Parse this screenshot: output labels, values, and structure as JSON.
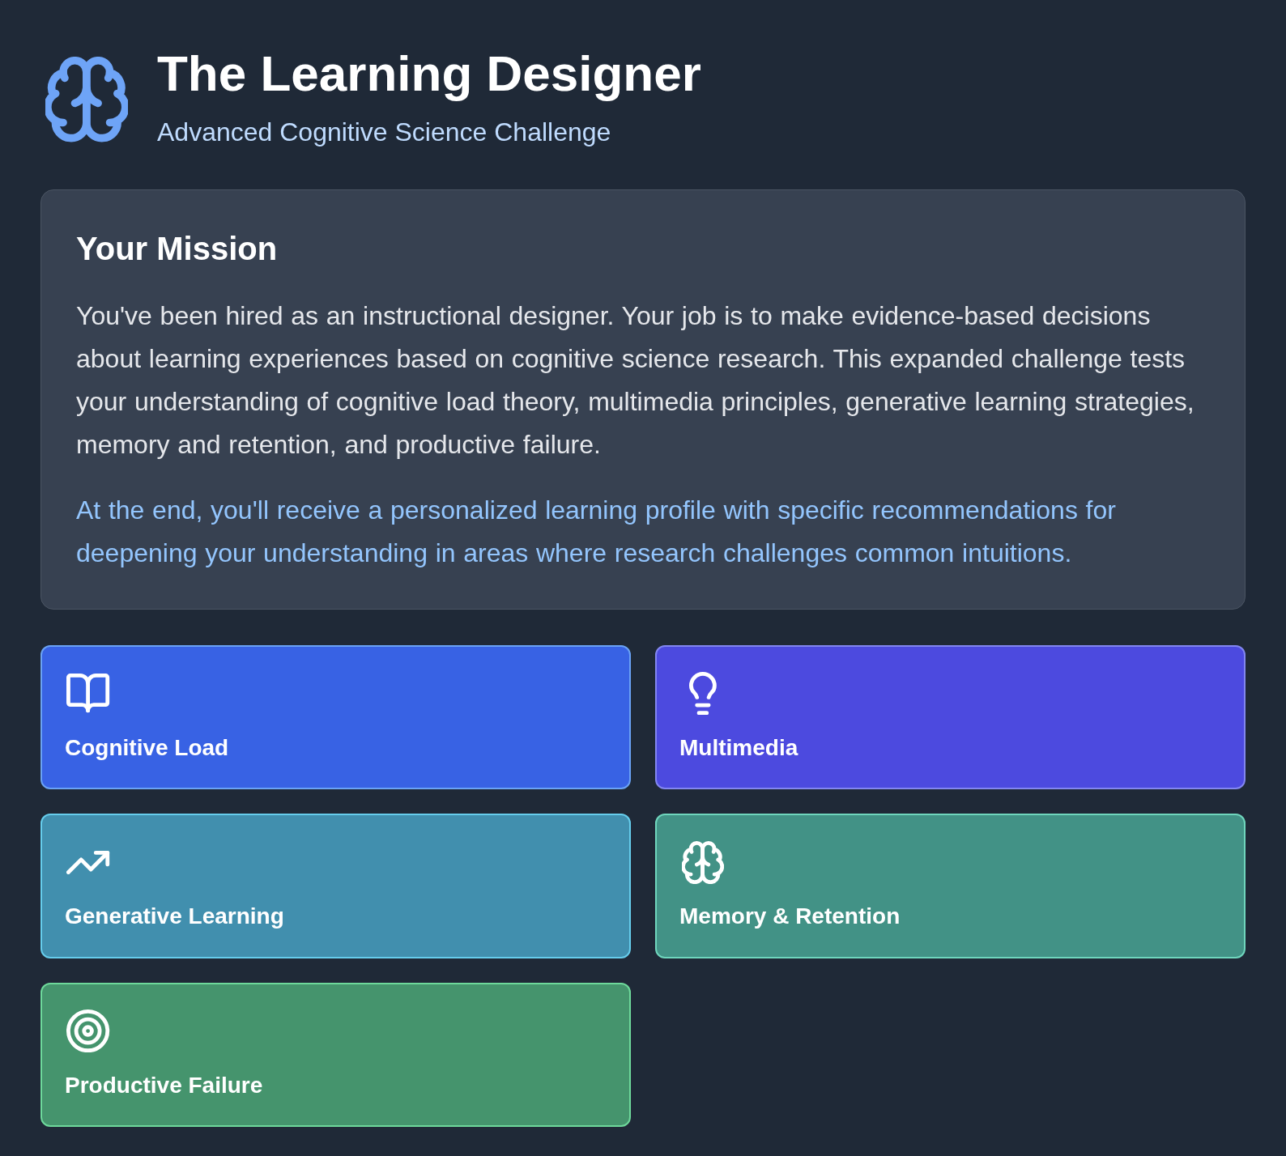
{
  "header": {
    "title": "The Learning Designer",
    "subtitle": "Advanced Cognitive Science Challenge"
  },
  "mission": {
    "title": "Your Mission",
    "paragraphs": [
      {
        "kind": "body",
        "text": "You've been hired as an instructional designer. Your job is to make evidence-based decisions about learning experiences based on cognitive science research. This expanded challenge tests your understanding of cognitive load theory, multimedia principles, generative learning strategies, memory and retention, and productive failure."
      },
      {
        "kind": "highlight",
        "text": "At the end, you'll receive a personalized learning profile with specific recommendations for deepening your understanding in areas where research challenges common intuitions."
      }
    ]
  },
  "topics": [
    {
      "label": "Cognitive Load",
      "kind": "book",
      "color": "#3862e4"
    },
    {
      "label": "Multimedia",
      "kind": "lightbulb",
      "color": "#4c4adf"
    },
    {
      "label": "Generative Learning",
      "kind": "trend",
      "color": "#418fae"
    },
    {
      "label": "Memory & Retention",
      "kind": "brain",
      "color": "#429286"
    },
    {
      "label": "Productive Failure",
      "kind": "target",
      "color": "#45946d"
    }
  ]
}
